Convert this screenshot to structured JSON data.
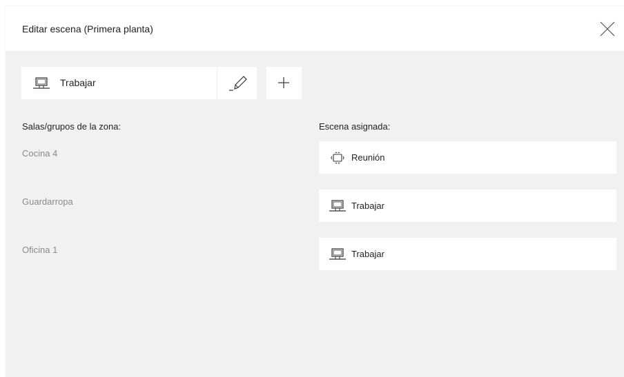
{
  "dialog": {
    "title": "Editar escena (Primera planta)",
    "close_icon": "close-icon"
  },
  "scene_selector": {
    "icon": "laptop-icon",
    "value": "Trabajar",
    "edit_icon": "pencil-icon",
    "add_icon": "plus-icon"
  },
  "columns": {
    "rooms_header": "Salas/grupos de la zona:",
    "scene_header": "Escena asignada:"
  },
  "rows": [
    {
      "room": "Cocina 4",
      "scene_icon": "meeting-table-icon",
      "scene": "Reunión"
    },
    {
      "room": "Guardarropa",
      "scene_icon": "laptop-icon",
      "scene": "Trabajar"
    },
    {
      "room": "Oficina 1",
      "scene_icon": "laptop-icon",
      "scene": "Trabajar"
    }
  ]
}
